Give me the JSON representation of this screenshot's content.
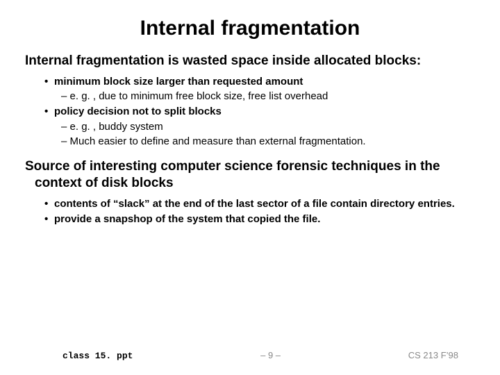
{
  "title": "Internal fragmentation",
  "heading1": "Internal fragmentation is wasted space inside allocated blocks:",
  "bullets1": [
    {
      "text": "minimum block size larger than requested amount",
      "subs": [
        "e. g. , due to minimum free block size, free list overhead"
      ]
    },
    {
      "text": "policy decision not to split blocks",
      "subs": [
        "e. g. , buddy system",
        "Much easier to define and measure than external fragmentation."
      ]
    }
  ],
  "heading2": "Source of interesting computer science forensic techniques in the context of disk blocks",
  "bullets2": [
    {
      "text": "contents of “slack” at the end of the last sector of a file contain directory entries.",
      "subs": []
    },
    {
      "text": "provide a snapshop of the system that copied the file.",
      "subs": []
    }
  ],
  "footer": {
    "file": "class 15. ppt",
    "page": "– 9 –",
    "course": "CS 213 F’98"
  }
}
